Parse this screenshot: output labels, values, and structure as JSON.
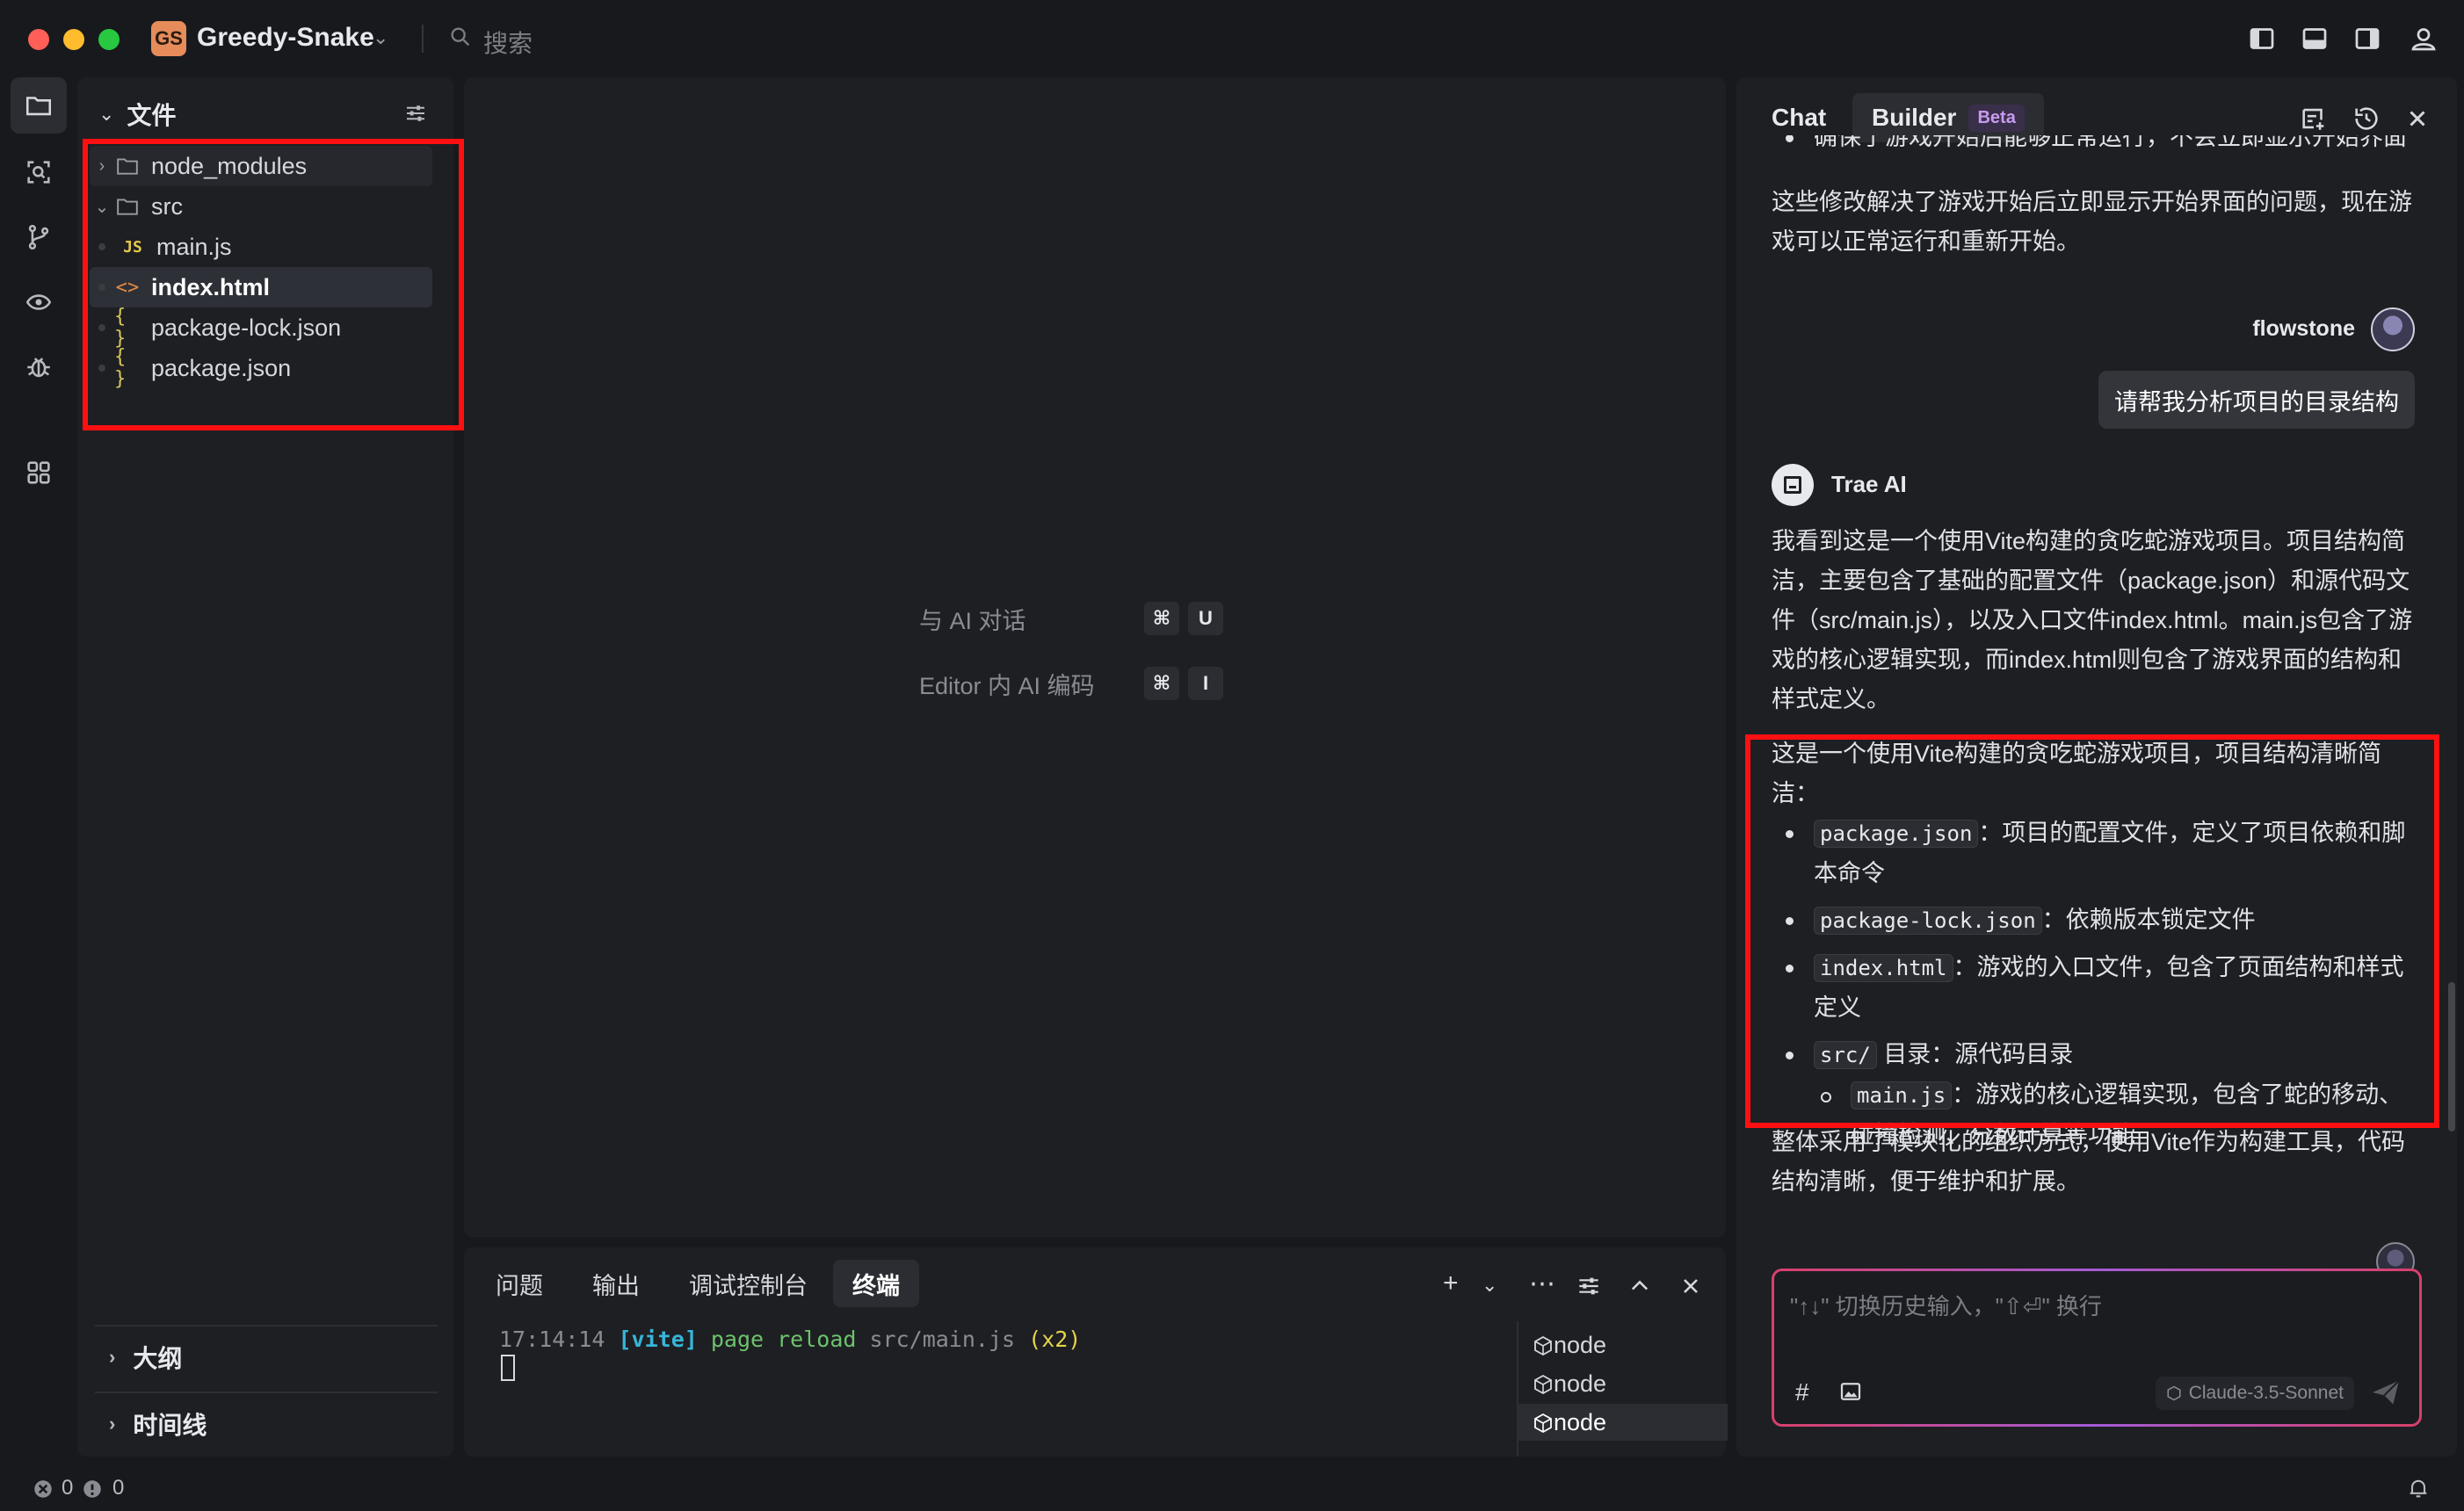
{
  "titlebar": {
    "project_badge": "GS",
    "project_name": "Greedy-Snake",
    "search_placeholder": "搜索"
  },
  "explorer": {
    "title": "文件",
    "items": [
      {
        "label": "node_modules",
        "type": "folder",
        "expanded": false
      },
      {
        "label": "src",
        "type": "folder",
        "expanded": true
      },
      {
        "label": "main.js",
        "type": "js",
        "icon": "JS"
      },
      {
        "label": "index.html",
        "type": "html",
        "icon": "<>"
      },
      {
        "label": "package-lock.json",
        "type": "json",
        "icon": "{ }"
      },
      {
        "label": "package.json",
        "type": "json",
        "icon": "{ }"
      }
    ],
    "outline": "大纲",
    "timeline": "时间线"
  },
  "editor": {
    "shortcuts": [
      {
        "label": "与 AI 对话",
        "keys": [
          "⌘",
          "U"
        ]
      },
      {
        "label": "Editor 内 AI 编码",
        "keys": [
          "⌘",
          "I"
        ]
      }
    ]
  },
  "panel": {
    "tabs": [
      "问题",
      "输出",
      "调试控制台",
      "终端"
    ],
    "active_tab": "终端",
    "terminal": {
      "time": "17:14:14",
      "tag": "[vite]",
      "msg": "page reload",
      "path": "src/main.js",
      "count": "(x2)"
    },
    "terminals": [
      "node",
      "node",
      "node"
    ]
  },
  "chat": {
    "tabs": {
      "chat": "Chat",
      "builder": "Builder",
      "beta": "Beta"
    },
    "partial_line": "确保了游戏开始后能够正常运行，不会立即显示开始界面",
    "prev_answer": "这些修改解决了游戏开始后立即显示开始界面的问题，现在游戏可以正常运行和重新开始。",
    "user_name": "flowstone",
    "user_message": "请帮我分析项目的目录结构",
    "ai_name": "Trae AI",
    "ai_intro": "我看到这是一个使用Vite构建的贪吃蛇游戏项目。项目结构简洁，主要包含了基础的配置文件（package.json）和源代码文件（src/main.js），以及入口文件index.html。main.js包含了游戏的核心逻辑实现，而index.html则包含了游戏界面的结构和样式定义。",
    "structure_heading": "这是一个使用Vite构建的贪吃蛇游戏项目，项目结构清晰简洁：",
    "structure": [
      {
        "code": "package.json",
        "desc": "：项目的配置文件，定义了项目依赖和脚本命令"
      },
      {
        "code": "package-lock.json",
        "desc": "：依赖版本锁定文件"
      },
      {
        "code": "index.html",
        "desc": "：游戏的入口文件，包含了页面结构和样式定义"
      },
      {
        "code": "src/",
        "desc": " 目录：源代码目录"
      },
      {
        "code": "main.js",
        "desc": "：游戏的核心逻辑实现，包含了蛇的移动、碰撞检测、分数计算等功能"
      }
    ],
    "summary": "整体采用了模块化的组织方式，使用Vite作为构建工具，代码结构清晰，便于维护和扩展。",
    "composer_placeholder": "\"↑↓\" 切换历史输入，\"⇧⏎\" 换行",
    "model": "Claude-3.5-Sonnet",
    "hash_label": "#"
  },
  "status": {
    "errors": "0",
    "warnings": "0"
  },
  "colors": {
    "highlight_box": "#ff1010",
    "accent_pink": "#d8406a",
    "vite_tag": "#36b5d8",
    "msg_green": "#6cc36c",
    "count_yellow": "#e5d44a"
  }
}
